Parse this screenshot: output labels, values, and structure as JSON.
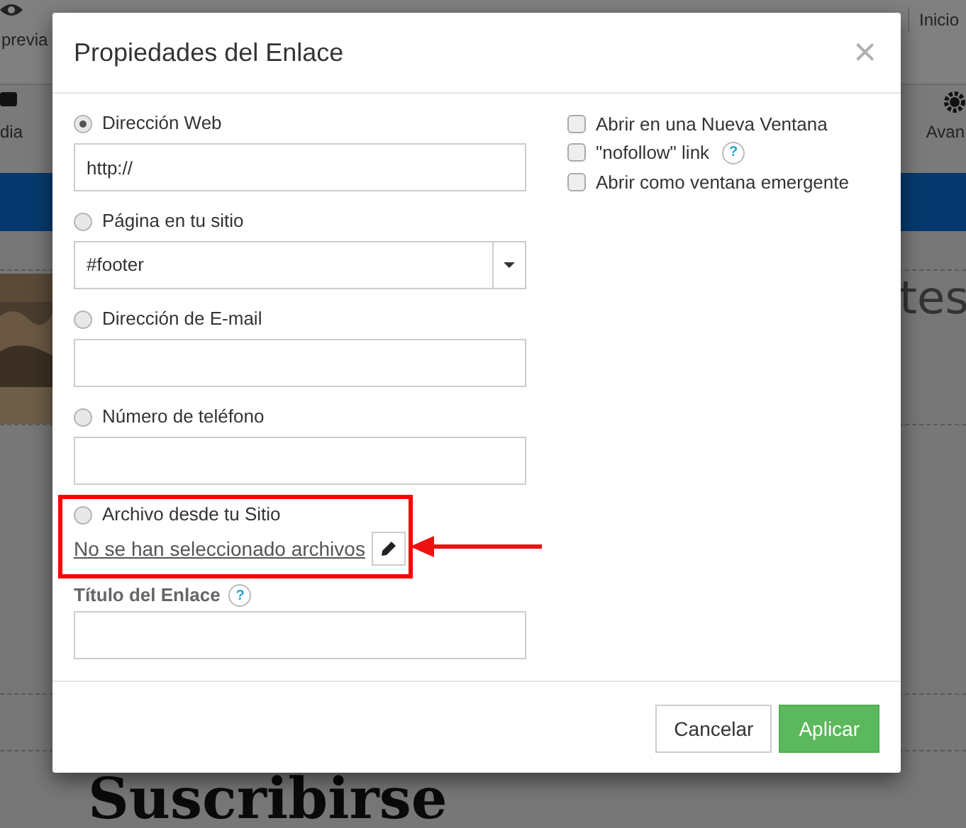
{
  "background": {
    "toolbar_top": {
      "left_label": "previa",
      "right_label": "Inicio"
    },
    "toolbar": {
      "labels": [
        "dia",
        "Avan"
      ]
    },
    "heading_fragment": "tes",
    "heading": "Suscribirse"
  },
  "dialog": {
    "title": "Propiedades del Enlace",
    "close": "×",
    "link_types": [
      {
        "kind": "field",
        "label": "Dirección Web",
        "selected": true,
        "value": "http://"
      },
      {
        "kind": "select",
        "label": "Página en tu sitio",
        "selected": false,
        "value": "#footer"
      },
      {
        "kind": "field",
        "label": "Dirección de E-mail",
        "selected": false
      },
      {
        "kind": "field",
        "label": "Número de teléfono",
        "selected": false
      },
      {
        "kind": "file",
        "label": "Archivo desde tu Sitio",
        "selected": false,
        "file_text": "No se han seleccionado archivos"
      }
    ],
    "title_field": {
      "label": "Título del Enlace",
      "help": "?"
    },
    "options": [
      {
        "label": "Abrir en una Nueva Ventana",
        "checked": false
      },
      {
        "label": "\"nofollow\" link",
        "checked": false,
        "help": "?"
      },
      {
        "label": "Abrir como ventana emergente",
        "checked": false
      }
    ],
    "buttons": [
      {
        "label": "Cancelar",
        "kind": "default"
      },
      {
        "label": "Aplicar",
        "kind": "primary"
      }
    ]
  }
}
